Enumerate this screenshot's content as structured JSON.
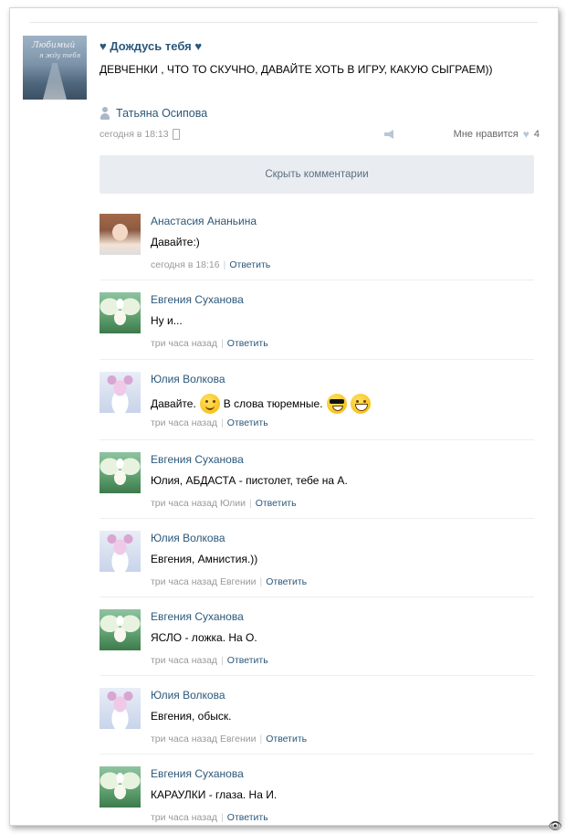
{
  "post": {
    "title": "♥ Дождусь тебя ♥",
    "thumb_text_1": "Любимый",
    "thumb_text_2": "я жду тебя",
    "text": "ДЕВЧЕНКИ , ЧТО ТО СКУЧНО, ДАВАЙТЕ ХОТЬ В ИГРУ, КАКУЮ СЫГРАЕМ))",
    "author": "Татьяна Осипова",
    "time": "сегодня в 18:13",
    "like_label": "Мне нравится",
    "like_count": "4"
  },
  "hide_comments_label": "Скрыть комментарии",
  "reply_label": "Ответить",
  "comments": [
    {
      "name": "Анастасия Ананьина",
      "text": "Давайте:)",
      "time": "сегодня в 18:16",
      "avatar": "girl-photo"
    },
    {
      "name": "Евгения Суханова",
      "text": "Ну и...",
      "time": "три часа назад",
      "avatar": "angel"
    },
    {
      "name": "Юлия Волкова",
      "text_1": "Давайте.",
      "text_2": "В слова тюремные.",
      "emoji_1": "smile-emoji",
      "emoji_2": "cool-emoji",
      "emoji_3": "grin-emoji",
      "time": "три часа назад",
      "avatar": "teddy-bear"
    },
    {
      "name": "Евгения Суханова",
      "text": "Юлия, АБДАСТА - пистолет, тебе на А.",
      "time": "три часа назад Юлии",
      "avatar": "angel"
    },
    {
      "name": "Юлия Волкова",
      "text": "Евгения, Амнистия.))",
      "time": "три часа назад Евгении",
      "avatar": "teddy-bear"
    },
    {
      "name": "Евгения Суханова",
      "text": "ЯСЛО - ложка. На О.",
      "time": "три часа назад",
      "avatar": "angel"
    },
    {
      "name": "Юлия Волкова",
      "text": "Евгения, обыск.",
      "time": "три часа назад Евгении",
      "avatar": "teddy-bear"
    },
    {
      "name": "Евгения Суханова",
      "text": "КАРАУЛКИ - глаза. На И.",
      "time": "три часа назад",
      "avatar": "angel"
    }
  ],
  "watermark": "👁"
}
